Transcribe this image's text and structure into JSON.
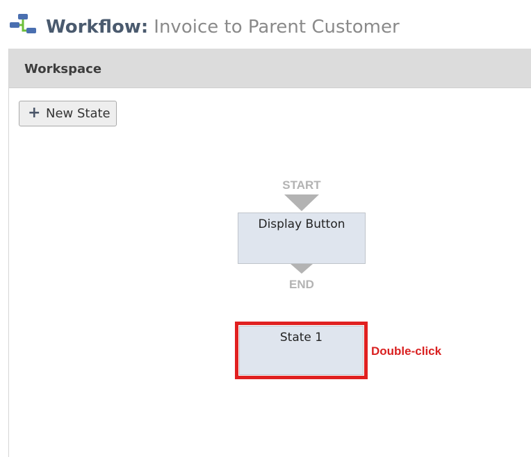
{
  "header": {
    "icon": "workflow-icon",
    "title_label": "Workflow:",
    "title_value": "Invoice to Parent Customer"
  },
  "workspace": {
    "title": "Workspace",
    "new_state_button": {
      "icon": "plus-icon",
      "label": "New State"
    }
  },
  "diagram": {
    "start_label": "START",
    "end_label": "END",
    "states": [
      {
        "name": "Display Button"
      },
      {
        "name": "State 1"
      }
    ],
    "annotation": "Double-click"
  },
  "colors": {
    "title_label": "#4a5a6e",
    "state_fill": "#dfe5ee",
    "highlight": "#e02020",
    "marker": "#b3b3b3"
  }
}
